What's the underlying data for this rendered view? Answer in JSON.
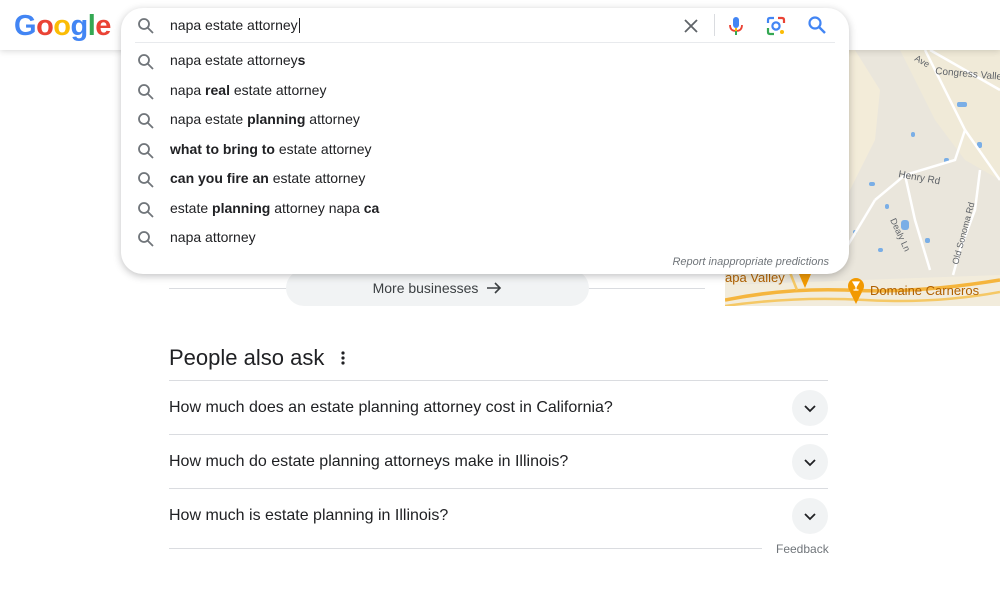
{
  "logo": {
    "letters": [
      "G",
      "o",
      "o",
      "g",
      "l",
      "e"
    ],
    "colors": [
      "#4285F4",
      "#EA4335",
      "#FBBC05",
      "#4285F4",
      "#34A853",
      "#EA4335"
    ]
  },
  "search": {
    "query": "napa estate attorney",
    "suggestions": [
      [
        {
          "t": "napa estate attorney",
          "b": false
        },
        {
          "t": "s",
          "b": true
        }
      ],
      [
        {
          "t": "napa ",
          "b": false
        },
        {
          "t": "real",
          "b": true
        },
        {
          "t": " estate attorney",
          "b": false
        }
      ],
      [
        {
          "t": "napa estate ",
          "b": false
        },
        {
          "t": "planning",
          "b": true
        },
        {
          "t": " attorney",
          "b": false
        }
      ],
      [
        {
          "t": "what to bring to",
          "b": true
        },
        {
          "t": " estate attorney",
          "b": false
        }
      ],
      [
        {
          "t": "can you fire an",
          "b": true
        },
        {
          "t": " estate attorney",
          "b": false
        }
      ],
      [
        {
          "t": "estate ",
          "b": false
        },
        {
          "t": "planning",
          "b": true
        },
        {
          "t": " attorney napa ",
          "b": false
        },
        {
          "t": "ca",
          "b": true
        }
      ],
      [
        {
          "t": "napa attorney",
          "b": false
        }
      ]
    ],
    "report_label": "Report inappropriate predictions"
  },
  "map": {
    "labels": [
      "Ave",
      "Congress Valley",
      "Henry Rd",
      "Dealy Ln",
      "Old Sonoma Rd",
      "apa Valley",
      "Domaine Carneros"
    ]
  },
  "more_businesses": {
    "label": "More businesses"
  },
  "paa": {
    "title": "People also ask",
    "questions": [
      "How much does an estate planning attorney cost in California?",
      "How much do estate planning attorneys make in Illinois?",
      "How much is estate planning in Illinois?"
    ],
    "feedback_label": "Feedback"
  },
  "colors": {
    "accent": "#1a73e8",
    "map_pin": "#f29900"
  }
}
